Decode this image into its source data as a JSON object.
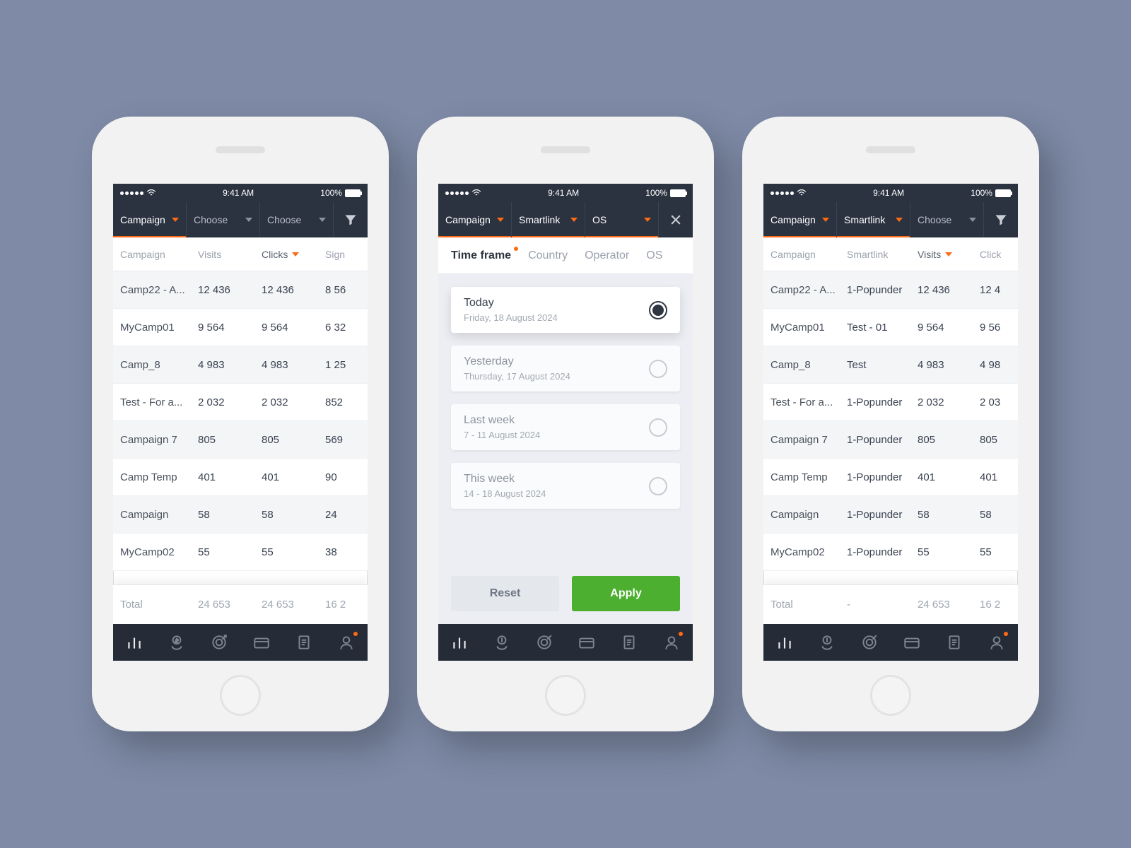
{
  "status": {
    "time": "9:41 AM",
    "battery": "100%"
  },
  "phoneA": {
    "segments": [
      "Campaign",
      "Choose",
      "Choose"
    ],
    "headers": [
      "Campaign",
      "Visits",
      "Clicks",
      "Sign"
    ],
    "rows": [
      {
        "c1": "Camp22 - A...",
        "c2": "12 436",
        "c3": "12 436",
        "c4": "8 56"
      },
      {
        "c1": "MyCamp01",
        "c2": "9 564",
        "c3": "9 564",
        "c4": "6 32"
      },
      {
        "c1": "Camp_8",
        "c2": "4 983",
        "c3": "4 983",
        "c4": "1 25"
      },
      {
        "c1": "Test - For a...",
        "c2": "2 032",
        "c3": "2 032",
        "c4": "852"
      },
      {
        "c1": "Campaign 7",
        "c2": "805",
        "c3": "805",
        "c4": "569"
      },
      {
        "c1": "Camp Temp",
        "c2": "401",
        "c3": "401",
        "c4": "90"
      },
      {
        "c1": "Campaign",
        "c2": "58",
        "c3": "58",
        "c4": "24"
      },
      {
        "c1": "MyCamp02",
        "c2": "55",
        "c3": "55",
        "c4": "38"
      }
    ],
    "totals": {
      "label": "Total",
      "c2": "24 653",
      "c3": "24 653",
      "c4": "16 2"
    }
  },
  "phoneB": {
    "segments": [
      "Campaign",
      "Smartlink",
      "OS"
    ],
    "tabs": [
      "Time frame",
      "Country",
      "Operator",
      "OS"
    ],
    "options": [
      {
        "title": "Today",
        "sub": "Friday, 18 August 2024",
        "selected": true
      },
      {
        "title": "Yesterday",
        "sub": "Thursday, 17 August 2024",
        "selected": false
      },
      {
        "title": "Last week",
        "sub": "7 - 11 August 2024",
        "selected": false
      },
      {
        "title": "This week",
        "sub": "14 - 18 August 2024",
        "selected": false
      }
    ],
    "actions": {
      "reset": "Reset",
      "apply": "Apply"
    }
  },
  "phoneC": {
    "segments": [
      "Campaign",
      "Smartlink",
      "Choose"
    ],
    "headers": [
      "Campaign",
      "Smartlink",
      "Visits",
      "Click"
    ],
    "rows": [
      {
        "c1": "Camp22 - A...",
        "c2": "1-Popunder",
        "c3": "12 436",
        "c4": "12 4"
      },
      {
        "c1": "MyCamp01",
        "c2": "Test - 01",
        "c3": "9 564",
        "c4": "9 56"
      },
      {
        "c1": "Camp_8",
        "c2": "Test",
        "c3": "4 983",
        "c4": "4 98"
      },
      {
        "c1": "Test - For a...",
        "c2": "1-Popunder",
        "c3": "2 032",
        "c4": "2 03"
      },
      {
        "c1": "Campaign 7",
        "c2": "1-Popunder",
        "c3": "805",
        "c4": "805"
      },
      {
        "c1": "Camp Temp",
        "c2": "1-Popunder",
        "c3": "401",
        "c4": "401"
      },
      {
        "c1": "Campaign",
        "c2": "1-Popunder",
        "c3": "58",
        "c4": "58"
      },
      {
        "c1": "MyCamp02",
        "c2": "1-Popunder",
        "c3": "55",
        "c4": "55"
      }
    ],
    "totals": {
      "label": "Total",
      "c2": "-",
      "c3": "24 653",
      "c4": "16 2"
    }
  }
}
